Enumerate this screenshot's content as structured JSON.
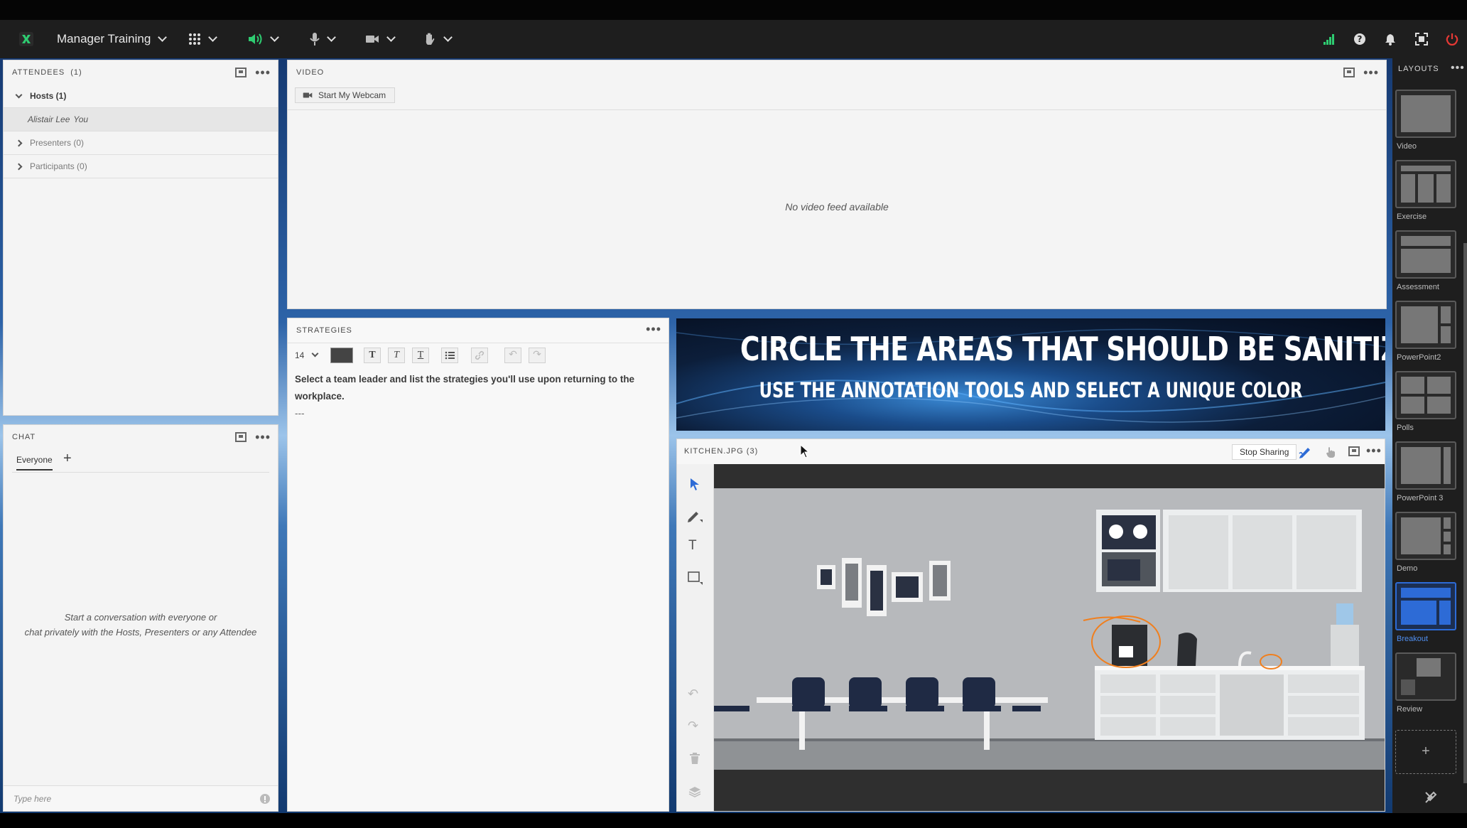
{
  "topbar": {
    "room_name": "Manager Training",
    "icons": [
      "apps-grid-icon",
      "speaker-icon",
      "microphone-icon",
      "camera-icon",
      "raise-hand-icon",
      "connection-strength-icon",
      "help-icon",
      "notifications-icon",
      "fullscreen-icon",
      "power-icon"
    ],
    "accent_color": "#2ecc71",
    "power_color": "#e53935"
  },
  "attendees": {
    "title": "ATTENDEES",
    "count": "(1)",
    "hosts_label": "Hosts (1)",
    "host_name": "Alistair Lee",
    "host_you": "You",
    "presenters_label": "Presenters (0)",
    "participants_label": "Participants (0)"
  },
  "chat": {
    "title": "CHAT",
    "tab_everyone": "Everyone",
    "empty_line1": "Start a conversation with everyone or",
    "empty_line2": "chat privately with the Hosts, Presenters or any Attendee",
    "input_placeholder": "Type here"
  },
  "video": {
    "title": "VIDEO",
    "start_webcam": "Start My Webcam",
    "no_feed": "No video feed available"
  },
  "strategies": {
    "title": "STRATEGIES",
    "font_size": "14",
    "text_color": "#444444",
    "body_line1": "Select a team leader and list the strategies you'll use upon returning to the",
    "body_line2": "workplace.",
    "body_line3": "---"
  },
  "banner": {
    "headline": "CIRCLE THE AREAS THAT SHOULD BE SANITIZED",
    "subline": "USE THE ANNOTATION TOOLS AND SELECT A UNIQUE COLOR"
  },
  "share": {
    "title": "KITCHEN.JPG (3)",
    "stop_sharing": "Stop Sharing",
    "annotation_color": "#f07f1e"
  },
  "layouts": {
    "title": "LAYOUTS",
    "items": [
      "Video",
      "Exercise",
      "Assessment",
      "PowerPoint2",
      "Polls",
      "PowerPoint 3",
      "Demo",
      "Breakout",
      "Review"
    ],
    "active": "Breakout",
    "active_color": "#2d6bd6",
    "add_label": "+"
  }
}
